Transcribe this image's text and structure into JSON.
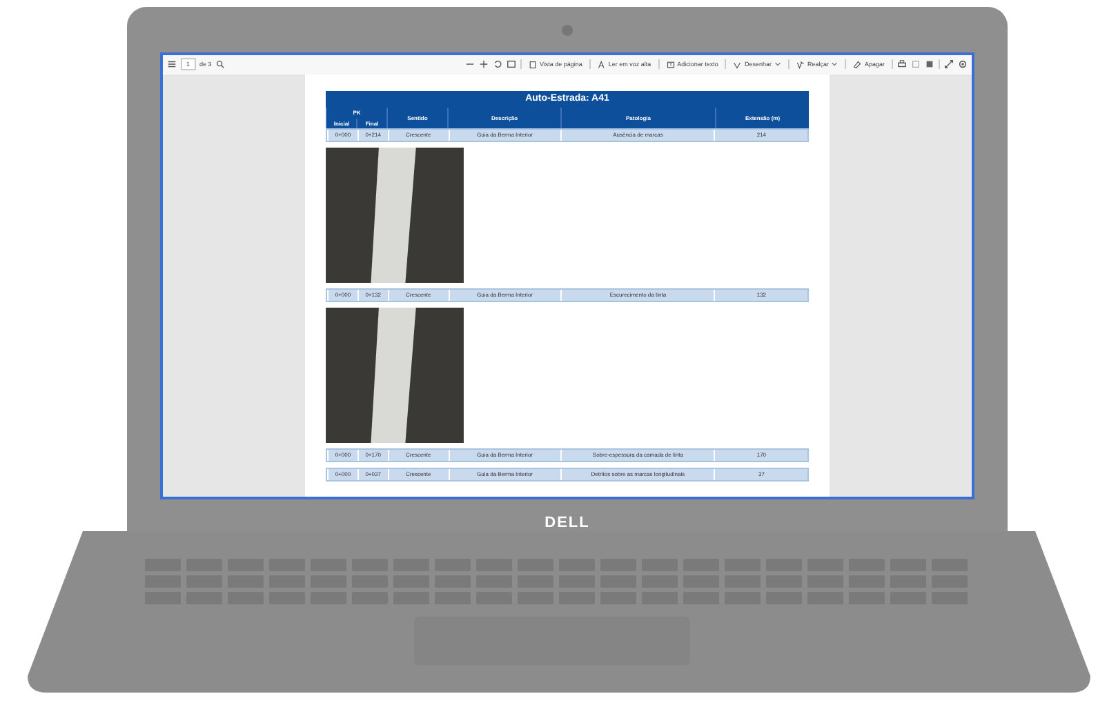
{
  "toolbar": {
    "page_number": "1",
    "page_total": "de 3",
    "tools": [
      {
        "kind": "page-view",
        "label": "Vista de página",
        "dropdown": false
      },
      {
        "kind": "read-aloud",
        "label": "Ler em voz alta",
        "dropdown": false
      },
      {
        "kind": "add-text",
        "label": "Adicionar texto",
        "dropdown": false
      },
      {
        "kind": "draw",
        "label": "Desenhar",
        "dropdown": true
      },
      {
        "kind": "highlight",
        "label": "Realçar",
        "dropdown": true
      },
      {
        "kind": "erase",
        "label": "Apagar",
        "dropdown": false
      }
    ]
  },
  "table": {
    "title": "Auto-Estrada: A41",
    "group_header": "PK",
    "columns": [
      "Inicial",
      "Final",
      "Sentido",
      "Descrição",
      "Patologia",
      "Extensão (m)"
    ]
  },
  "blocks": [
    {
      "kind": "row",
      "cells": [
        "0+000",
        "0+214",
        "Crescente",
        "Guia da Berma Interior",
        "Ausência de marcas",
        "214"
      ]
    },
    {
      "kind": "photo"
    },
    {
      "kind": "row",
      "cells": [
        "0+000",
        "0+132",
        "Crescente",
        "Guia da Berma Interior",
        "Escurecimento da tinta",
        "132"
      ]
    },
    {
      "kind": "photo"
    },
    {
      "kind": "row",
      "cells": [
        "0+000",
        "0+170",
        "Crescente",
        "Guia da Berma Interior",
        "Sobre-espessura da camada de tinta",
        "170"
      ]
    },
    {
      "kind": "row",
      "cells": [
        "0+000",
        "0+037",
        "Crescente",
        "Guia da Berma Interior",
        "Detritos sobre as marcas longitudinais",
        "37"
      ]
    }
  ],
  "brand": "DELL"
}
